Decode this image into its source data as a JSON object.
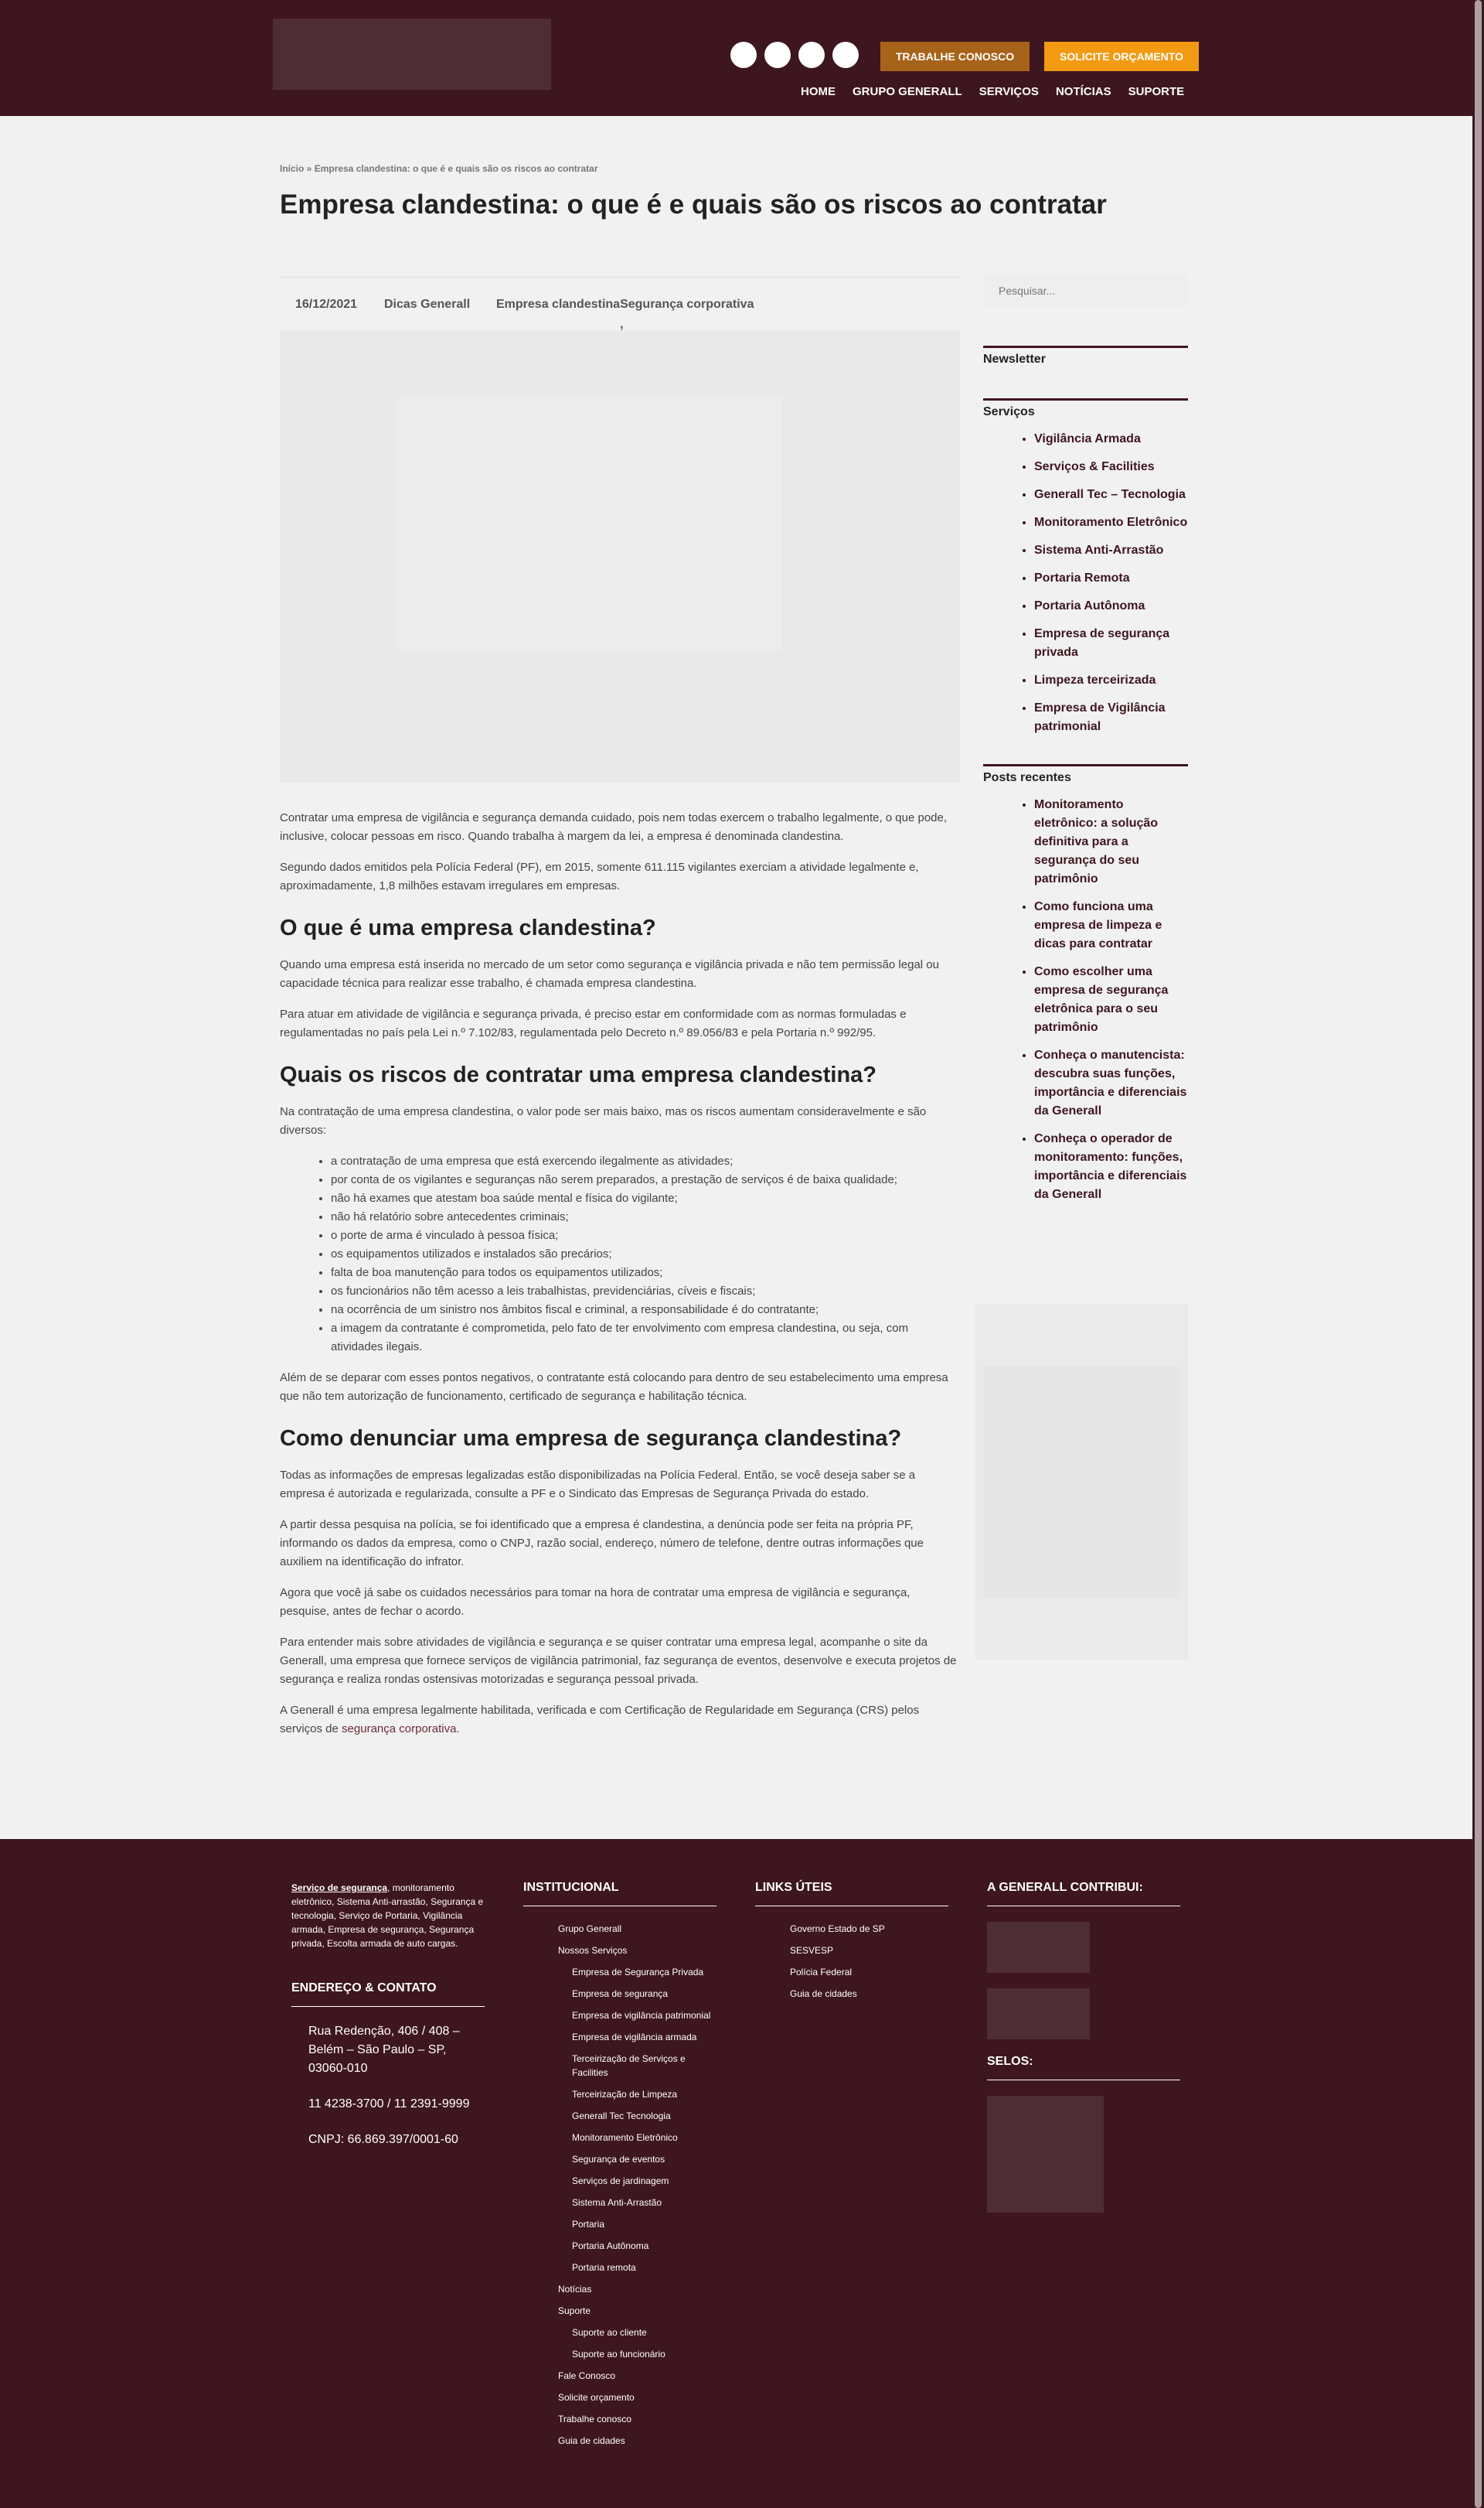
{
  "header": {
    "work_button": "TRABALHE CONOSCO",
    "quote_button": "SOLICITE ORÇAMENTO",
    "nav": [
      "HOME",
      "GRUPO GENERALL",
      "SERVIÇOS",
      "NOTÍCIAS",
      "SUPORTE"
    ]
  },
  "breadcrumb": {
    "home": "Início",
    "sep": " » ",
    "current": "Empresa clandestina: o que é e quais são os riscos ao contratar"
  },
  "page_title": "Empresa clandestina: o que é e quais são os riscos ao contratar",
  "meta": {
    "date": "16/12/2021",
    "category": "Dicas Generall",
    "tag1": "Empresa clandestina",
    "tag_sep": ", ",
    "tag2": "Segurança corporativa"
  },
  "article": {
    "p1": "Contratar uma empresa de vigilância e segurança demanda cuidado, pois nem todas exercem o trabalho legalmente, o que pode, inclusive, colocar pessoas em risco. Quando trabalha à margem da lei, a empresa é denominada clandestina.",
    "p2": "Segundo dados emitidos pela Polícia Federal (PF), em 2015, somente 611.115 vigilantes exerciam a atividade legalmente e, aproximadamente, 1,8 milhões estavam irregulares em empresas.",
    "h1": "O que é uma empresa clandestina?",
    "p3": "Quando uma empresa está inserida no mercado de um setor como segurança e vigilância privada e não tem permissão legal ou capacidade técnica para realizar esse trabalho, é chamada empresa clandestina.",
    "p4": "Para atuar em atividade de vigilância e segurança privada, é preciso estar em conformidade com as normas formuladas e regulamentadas no país pela Lei n.º 7.102/83, regulamentada pelo Decreto n.º 89.056/83 e pela Portaria n.º 992/95.",
    "h2": "Quais os riscos de contratar uma empresa clandestina?",
    "p5": "Na contratação de uma empresa clandestina, o valor pode ser mais baixo, mas os riscos aumentam consideravelmente e são diversos:",
    "risks": [
      "a contratação de uma empresa que está exercendo ilegalmente as atividades;",
      "por conta de os vigilantes e seguranças não serem preparados, a prestação de serviços é de baixa qualidade;",
      "não há exames que atestam boa saúde mental e física do vigilante;",
      "não há relatório sobre antecedentes criminais;",
      "o porte de arma é vinculado à pessoa física;",
      "os equipamentos utilizados e instalados são precários;",
      "falta de boa manutenção para todos os equipamentos utilizados;",
      "os funcionários não têm acesso a leis trabalhistas, previdenciárias, cíveis e fiscais;",
      "na ocorrência de um sinistro nos âmbitos fiscal e criminal, a responsabilidade é do contratante;",
      "a imagem da contratante é comprometida, pelo fato de ter envolvimento com empresa clandestina, ou seja, com atividades ilegais."
    ],
    "p6": "Além de se deparar com esses pontos negativos, o contratante está colocando para dentro de seu estabelecimento uma empresa que não tem autorização de funcionamento, certificado de segurança e habilitação técnica.",
    "h3": "Como denunciar uma empresa de segurança clandestina?",
    "p7": "Todas as informações de empresas legalizadas estão disponibilizadas na Polícia Federal. Então, se você deseja saber se a empresa é autorizada e regularizada, consulte a PF e o Sindicato das Empresas de Segurança Privada do estado.",
    "p8": "A partir dessa pesquisa na polícia, se foi identificado que a empresa é clandestina, a denúncia pode ser feita na própria PF, informando os dados da empresa, como o CNPJ, razão social, endereço, número de telefone, dentre outras informações que auxiliem na identificação do infrator.",
    "p9": "Agora que você já sabe os cuidados necessários para tomar na hora de contratar uma empresa de vigilância e segurança, pesquise, antes de fechar o acordo.",
    "p10": "Para entender mais sobre atividades de vigilância e segurança e se quiser contratar uma empresa legal, acompanhe o site da Generall, uma empresa que fornece serviços de vigilância patrimonial, faz segurança de eventos, desenvolve e executa projetos de segurança e realiza rondas ostensivas motorizadas e segurança pessoal privada.",
    "p11_pre": "A Generall é uma empresa legalmente habilitada, verificada e com Certificação de Regularidade em Segurança (CRS) pelos serviços de ",
    "p11_link": "segurança corporativa",
    "p11_post": "."
  },
  "sidebar": {
    "search_placeholder": "Pesquisar...",
    "newsletter_title": "Newsletter",
    "services_title": "Serviços",
    "services": [
      "Vigilância Armada",
      "Serviços & Facilities",
      "Generall Tec – Tecnologia",
      "Monitoramento Eletrônico",
      "Sistema Anti-Arrastão",
      "Portaria Remota",
      "Portaria Autônoma",
      "Empresa de segurança privada",
      "Limpeza terceirizada",
      "Empresa de Vigilância patrimonial"
    ],
    "recent_title": "Posts recentes",
    "recent": [
      "Monitoramento eletrônico: a solução definitiva para a segurança do seu patrimônio",
      "Como funciona uma empresa de limpeza e dicas para contratar",
      "Como escolher uma empresa de segurança eletrônica para o seu patrimônio",
      "Conheça o manutencista: descubra suas funções, importância e diferenciais da Generall",
      "Conheça o operador de monitoramento: funções, importância e diferenciais da Generall"
    ]
  },
  "footer": {
    "about_link": "Serviço de segurança",
    "about_text": ", monitoramento eletrônico, Sistema Anti-arrastão, Segurança e tecnologia, Serviço de Portaria, Vigilância armada, Empresa de segurança, Segurança privada, Escolta armada de auto cargas.",
    "address_title": "ENDEREÇO & CONTATO",
    "address": "Rua Redenção, 406 / 408 – Belém – São Paulo – SP, 03060-010",
    "phone": "11 4238-3700 / 11 2391-9999",
    "cnpj": "CNPJ: 66.869.397/0001-60",
    "inst_title": "INSTITUCIONAL",
    "inst": [
      {
        "label": "Grupo Generall",
        "sub": false
      },
      {
        "label": "Nossos Serviços",
        "sub": false
      },
      {
        "label": "Empresa de Segurança Privada",
        "sub": true
      },
      {
        "label": "Empresa de segurança",
        "sub": true
      },
      {
        "label": "Empresa de vigilância patrimonial",
        "sub": true
      },
      {
        "label": "Empresa de vigilância armada",
        "sub": true
      },
      {
        "label": "Terceirização de Serviços e Facilities",
        "sub": true
      },
      {
        "label": "Terceirização de Limpeza",
        "sub": true
      },
      {
        "label": "Generall Tec Tecnologia",
        "sub": true
      },
      {
        "label": "Monitoramento Eletrônico",
        "sub": true
      },
      {
        "label": "Segurança de eventos",
        "sub": true
      },
      {
        "label": "Serviços de jardinagem",
        "sub": true
      },
      {
        "label": "Sistema Anti-Arrastão",
        "sub": true
      },
      {
        "label": "Portaria",
        "sub": true
      },
      {
        "label": "Portaria Autônoma",
        "sub": true
      },
      {
        "label": "Portaria remota",
        "sub": true
      },
      {
        "label": "Notícias",
        "sub": false
      },
      {
        "label": "Suporte",
        "sub": false
      },
      {
        "label": "Suporte ao cliente",
        "sub": true
      },
      {
        "label": "Suporte ao funcionário",
        "sub": true
      },
      {
        "label": "Fale Conosco",
        "sub": false
      },
      {
        "label": "Solicite orçamento",
        "sub": false
      },
      {
        "label": "Trabalhe conosco",
        "sub": false
      },
      {
        "label": "Guia de cidades",
        "sub": false
      }
    ],
    "links_title": "LINKS ÚTEIS",
    "links": [
      "Governo Estado de SP",
      "SESVESP",
      "Polícia Federal",
      "Guia de cidades"
    ],
    "contrib_title": "A GENERALL CONTRIBUI:",
    "seals_title": "SELOS:"
  }
}
